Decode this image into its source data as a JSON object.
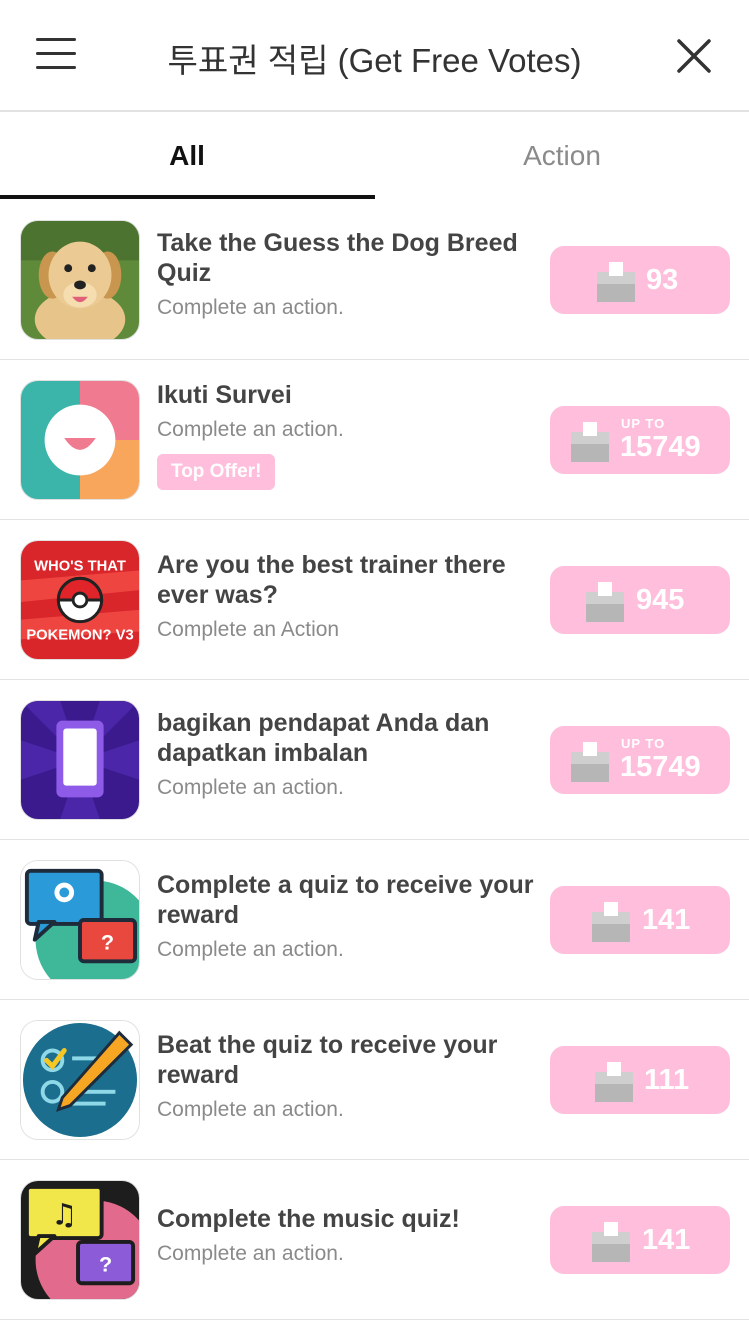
{
  "header": {
    "title": "투표권 적립 (Get Free Votes)",
    "menu_icon": "hamburger-menu-icon",
    "close_icon": "close-icon"
  },
  "tabs": [
    {
      "label": "All",
      "active": true
    },
    {
      "label": "Action",
      "active": false
    }
  ],
  "colors": {
    "vote_button_bg": "#ffbedc",
    "text_primary": "#444444",
    "text_secondary": "#8a8a8a"
  },
  "offers": [
    {
      "title": "Take the Guess the Dog Breed Quiz",
      "subtitle": "Complete an action.",
      "votes": "93",
      "up_to": "",
      "badge": "",
      "icon": "puppy-photo-icon"
    },
    {
      "title": "Ikuti Survei",
      "subtitle": "Complete an action.",
      "votes": "15749",
      "up_to": "UP TO",
      "badge": "Top Offer!",
      "icon": "survey-app-icon"
    },
    {
      "title": "Are you the best trainer there ever was?",
      "subtitle": "Complete an Action",
      "votes": "945",
      "up_to": "",
      "badge": "",
      "icon": "pokemon-quiz-icon",
      "icon_text_top": "WHO'S THAT",
      "icon_text_bottom": "POKEMON? V3"
    },
    {
      "title": "bagikan pendapat Anda dan dapatkan imbalan",
      "subtitle": "Complete an action.",
      "votes": "15749",
      "up_to": "UP TO",
      "badge": "",
      "icon": "phone-app-icon"
    },
    {
      "title": "Complete a quiz to receive your reward",
      "subtitle": "Complete an action.",
      "votes": "141",
      "up_to": "",
      "badge": "",
      "icon": "quiz-chat-icon"
    },
    {
      "title": "Beat the quiz to receive your reward",
      "subtitle": "Complete an action.",
      "votes": "111",
      "up_to": "",
      "badge": "",
      "icon": "checklist-pencil-icon"
    },
    {
      "title": "Complete the music quiz!",
      "subtitle": "Complete an action.",
      "votes": "141",
      "up_to": "",
      "badge": "",
      "icon": "music-quiz-icon"
    }
  ]
}
